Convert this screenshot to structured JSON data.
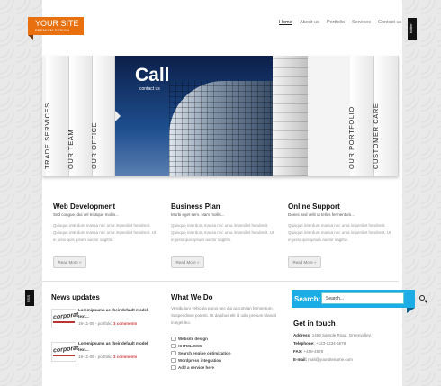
{
  "logo": {
    "title": "YOUR SITE",
    "subtitle": "PREMIUM DESIGN"
  },
  "nav": [
    "Home",
    "About us",
    "Portfolio",
    "Services",
    "Contact us"
  ],
  "side_tabs": {
    "twitter": "twitter",
    "rss": "RSS"
  },
  "slider": {
    "left_tabs": [
      "TRADE SERVICES",
      "OUR TEAM",
      "OUR OFFICE"
    ],
    "right_tabs": [
      "OUR PORTFOLIO",
      "CUSTOMER CARE"
    ],
    "title": "Call",
    "subtitle": "contact us"
  },
  "columns": [
    {
      "title": "Web Development",
      "subtitle": "Sed congue, dui vel tristique mollis...",
      "body": "Quisque interdum massa nec uma imperdiet hendrerit. Quisque interdum massa nec uma imperdiet hendrerit. Ut in justo quis ipsum auctor sagittis.",
      "more": "Read More »"
    },
    {
      "title": "Business Plan",
      "subtitle": "Morbi eget sem. Nam mollis...",
      "body": "Quisque interdum massa nec uma imperdiet hendrerit. Quisque interdum massa nec uma imperdiet hendrerit. Ut in justo quis ipsum auctor sagittis.",
      "more": "Read More »"
    },
    {
      "title": "Online Support",
      "subtitle": "Donec sed velit ut tellus fermentum...",
      "body": "Quisque interdum massa nec uma imperdiet hendrerit. Quisque interdum massa nec uma imperdiet hendrerit. Ut in justo quis ipsum auctor sagittis.",
      "more": "Read More »"
    }
  ],
  "news": {
    "title": "News updates",
    "items": [
      {
        "thumb": "corporat",
        "text": "Loremipsums as their default model text...",
        "date": "19-11-09 - portfolio",
        "comments": "3 comments"
      },
      {
        "thumb": "corporat",
        "text": "Loremipsums as their default model text...",
        "date": "19-11-09 - portfolio",
        "comments": "3 comments"
      }
    ]
  },
  "what_we_do": {
    "title": "What We Do",
    "body": "Vestibulum vehicula purus nec dui accumsan fermentum. Suspendisse potenti. Ut dapibus elit id odio pretium blandit in eget leo.",
    "items": [
      "Website design",
      "XHTML/CSS",
      "Search engine optimization",
      "Wordpress integration",
      "Add a service here"
    ]
  },
  "search": {
    "label": "Search:",
    "placeholder": "Search..."
  },
  "touch": {
    "title": "Get in touch",
    "address_label": "Address:",
    "address": "1459 Sample Road, Greenvalley,",
    "phone_label": "Telephone:",
    "phone": "+123-1234-5678",
    "fax_label": "FAX:",
    "fax": "+458-4578",
    "email_label": "E-mail:",
    "email": "mail@yoursitename.com"
  },
  "colors": {
    "accent": "#e8700f",
    "search_bg": "#1cace6"
  }
}
